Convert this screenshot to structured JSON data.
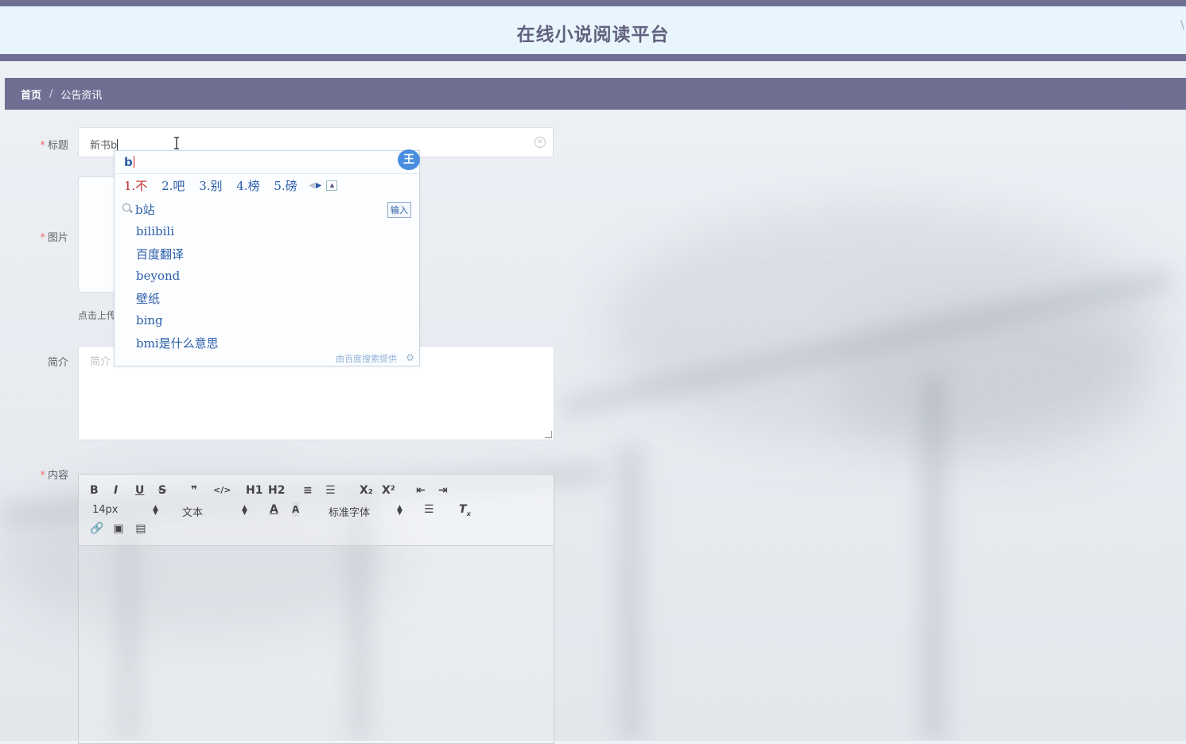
{
  "header": {
    "title": "在线小说阅读平台",
    "corner_glyph": "\\"
  },
  "breadcrumb": {
    "items": [
      "首页",
      "公告资讯"
    ],
    "separator": "/"
  },
  "form": {
    "title_label": "标题",
    "title_value": "新书b",
    "image_label": "图片",
    "upload_tip": "点击上传",
    "intro_label": "简介",
    "intro_placeholder": "简介",
    "content_label": "内容",
    "required_mark": "*"
  },
  "editor": {
    "buttons": [
      "B",
      "I",
      "U",
      "S",
      "❞",
      "</>",
      "H1",
      "H2",
      "≡",
      "☰",
      "X₂",
      "X²",
      "⇤",
      "⇥"
    ],
    "font_size": "14px",
    "text_style": "文本",
    "font_family": "标准字体"
  },
  "ime": {
    "composition": "b",
    "badge": "王",
    "candidates": [
      "1.不",
      "2.吧",
      "3.别",
      "4.榜",
      "5.磅"
    ],
    "search_query": "b站",
    "input_button": "输入",
    "suggestions": [
      "bilibili",
      "百度翻译",
      "beyond",
      "壁纸",
      "bing",
      "bmi是什么意思"
    ],
    "footer": "由百度搜索提供"
  }
}
